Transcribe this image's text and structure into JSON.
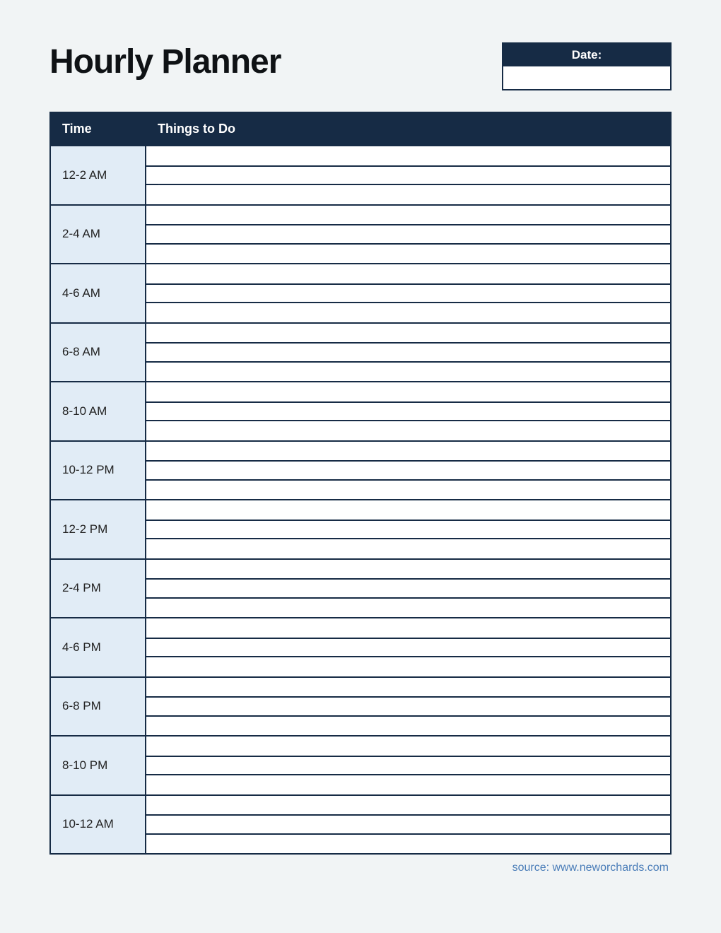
{
  "title": "Hourly Planner",
  "date_label": "Date:",
  "date_value": "",
  "columns": {
    "time": "Time",
    "things": "Things to Do"
  },
  "rows": [
    {
      "time": "12-2 AM",
      "entries": [
        "",
        "",
        ""
      ]
    },
    {
      "time": "2-4 AM",
      "entries": [
        "",
        "",
        ""
      ]
    },
    {
      "time": "4-6 AM",
      "entries": [
        "",
        "",
        ""
      ]
    },
    {
      "time": "6-8 AM",
      "entries": [
        "",
        "",
        ""
      ]
    },
    {
      "time": "8-10 AM",
      "entries": [
        "",
        "",
        ""
      ]
    },
    {
      "time": "10-12 PM",
      "entries": [
        "",
        "",
        ""
      ]
    },
    {
      "time": "12-2 PM",
      "entries": [
        "",
        "",
        ""
      ]
    },
    {
      "time": "2-4 PM",
      "entries": [
        "",
        "",
        ""
      ]
    },
    {
      "time": "4-6 PM",
      "entries": [
        "",
        "",
        ""
      ]
    },
    {
      "time": "6-8 PM",
      "entries": [
        "",
        "",
        ""
      ]
    },
    {
      "time": "8-10 PM",
      "entries": [
        "",
        "",
        ""
      ]
    },
    {
      "time": "10-12 AM",
      "entries": [
        "",
        "",
        ""
      ]
    }
  ],
  "source": "source: www.neworchards.com"
}
